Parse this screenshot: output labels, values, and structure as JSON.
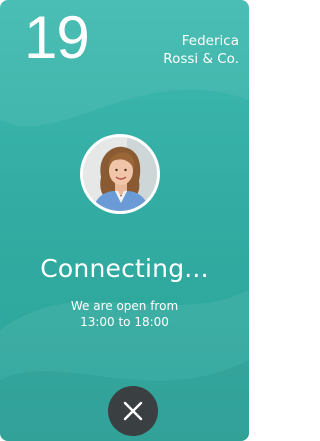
{
  "header": {
    "day_number": "19",
    "company_line1": "Federica",
    "company_line2": "Rossi & Co."
  },
  "call": {
    "status": "Connecting...",
    "hours_line1": "We are open from",
    "hours_line2": "13:00 to 18:00"
  },
  "icons": {
    "avatar": "person-photo",
    "close": "close-icon"
  },
  "colors": {
    "background": "#33ada3",
    "close_button": "#3a3f42",
    "text": "#ffffff"
  }
}
